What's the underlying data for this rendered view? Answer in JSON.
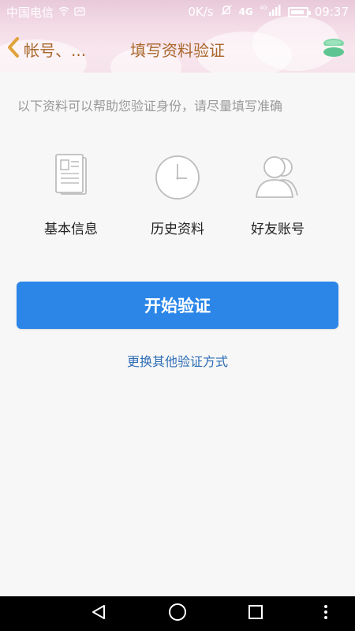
{
  "status_bar": {
    "carrier": "中国电信",
    "speed": "0K/s",
    "network": "4G",
    "network_small": "4G",
    "time": "09:37"
  },
  "nav": {
    "back_label": "帐号、...",
    "title": "填写资料验证"
  },
  "hint": "以下资料可以帮助您验证身份，请尽量填写准确",
  "options": [
    {
      "label": "基本信息",
      "icon": "document-icon"
    },
    {
      "label": "历史资料",
      "icon": "clock-icon"
    },
    {
      "label": "好友账号",
      "icon": "friends-icon"
    }
  ],
  "start_button": "开始验证",
  "other_method_link": "更换其他验证方式",
  "colors": {
    "accent": "#2b86e8",
    "title": "#a9672b",
    "link": "#2d6db6"
  }
}
